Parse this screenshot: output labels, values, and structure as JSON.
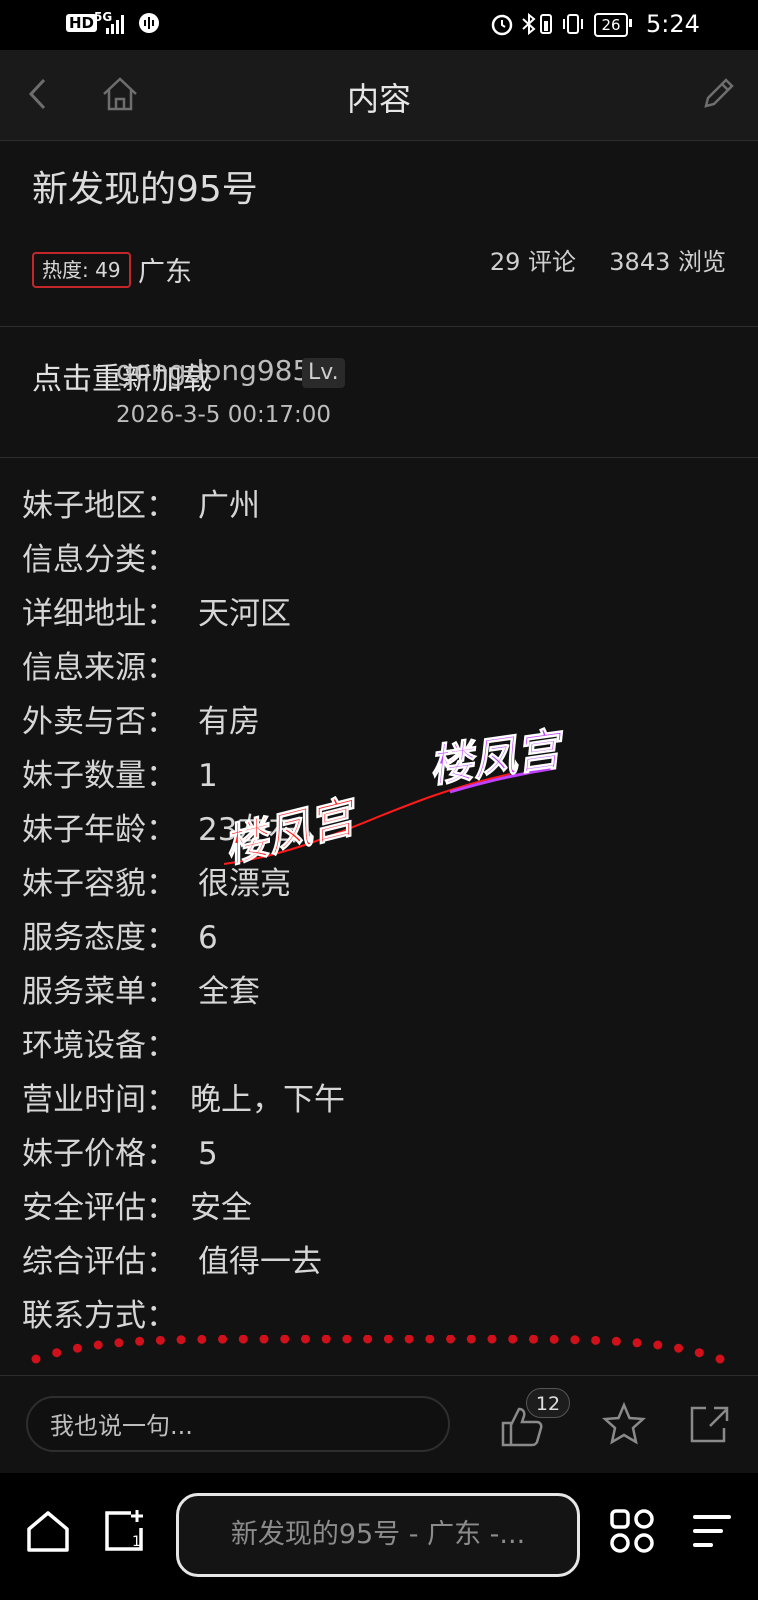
{
  "status_bar": {
    "left_icons": [
      "HD",
      "5G"
    ],
    "time": "5:24",
    "battery": "26"
  },
  "nav": {
    "title": "内容"
  },
  "post": {
    "title": "新发现的95号",
    "heat": "热度: 49",
    "region": "广东",
    "comments": "29 评论",
    "views": "3843 浏览"
  },
  "author": {
    "reload_text": "点击重新加载",
    "name": "gongdong985",
    "level": "Lv.",
    "time": "2026-3-5 00:17:00"
  },
  "fields": [
    {
      "label": "妹子地区：",
      "value": "广州"
    },
    {
      "label": "信息分类：",
      "value": ""
    },
    {
      "label": "详细地址：",
      "value": "天河区"
    },
    {
      "label": "信息来源：",
      "value": ""
    },
    {
      "label": "外卖与否：",
      "value": "有房"
    },
    {
      "label": "妹子数量：",
      "value": "1"
    },
    {
      "label": "妹子年龄：",
      "value": "23左右"
    },
    {
      "label": "妹子容貌：",
      "value": "很漂亮"
    },
    {
      "label": "服务态度：",
      "value": "6"
    },
    {
      "label": "服务菜单：",
      "value": "全套"
    },
    {
      "label": "环境设备：",
      "value": ""
    },
    {
      "label": "营业时间：",
      "value": "晚上，下午"
    },
    {
      "label": "妹子价格：",
      "value": "5"
    },
    {
      "label": "安全评估：",
      "value": "安全"
    },
    {
      "label": "综合评估：",
      "value": "值得一去"
    },
    {
      "label": "联系方式：",
      "value": ""
    }
  ],
  "watermarks": [
    "楼凤宫",
    "楼凤宫"
  ],
  "comment_bar": {
    "placeholder": "我也说一句...",
    "like_count": "12"
  },
  "browser_bar": {
    "url_title": "新发现的95号 - 广东 -..."
  },
  "colors": {
    "accent_red": "#c3262b",
    "watermark_red": "#ff1a1a",
    "watermark_purple": "#c040ff"
  }
}
